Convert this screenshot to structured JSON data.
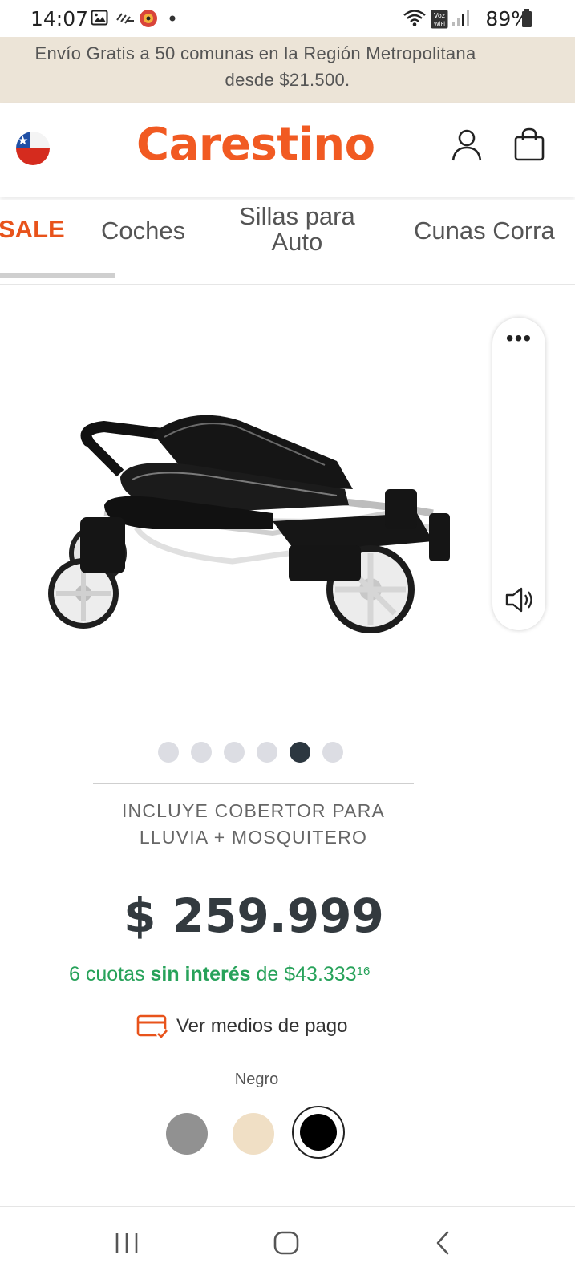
{
  "status_bar": {
    "time": "14:07",
    "battery": "89%",
    "icons": [
      "gallery-icon",
      "weather-icon",
      "app-notification-icon",
      "dot-icon",
      "wifi-icon",
      "volte-icon",
      "signal-icon",
      "battery-icon"
    ]
  },
  "promo": {
    "line1": "Envío Gratis a 50 comunas en la Región Metropolitana",
    "line2": "desde $21.500."
  },
  "header": {
    "logo": "Carestino",
    "brand_color": "#f15a22",
    "icons": [
      "chile-flag-icon",
      "user-icon",
      "shopping-bag-icon"
    ]
  },
  "categories": {
    "items": [
      {
        "label": "SALE"
      },
      {
        "label": "Coches"
      },
      {
        "label_line1": "Sillas para",
        "label_line2": "Auto"
      },
      {
        "label": "Cunas Corra"
      }
    ]
  },
  "widget": {
    "menu": "•••",
    "icons": [
      "more-icon",
      "speaker-icon"
    ]
  },
  "carousel": {
    "count": 6,
    "active_index": 4
  },
  "product": {
    "includes_line1": "INCLUYE COBERTOR PARA",
    "includes_line2": "LLUVIA + MOSQUITERO",
    "price": "$ 259.999",
    "installments_prefix": "6 cuotas",
    "installments_bold": "sin interés",
    "installments_mid": "de",
    "installments_amount": "$43.333",
    "installments_cents": "16",
    "installments_color": "#27a25a",
    "payment_link": "Ver medios de pago",
    "color_label": "Negro",
    "colors": [
      "#919191",
      "#f0dfc5",
      "#000000"
    ],
    "selected_color_index": 2
  },
  "navbar": {
    "icons": [
      "recent-apps-icon",
      "home-icon",
      "back-icon"
    ]
  }
}
